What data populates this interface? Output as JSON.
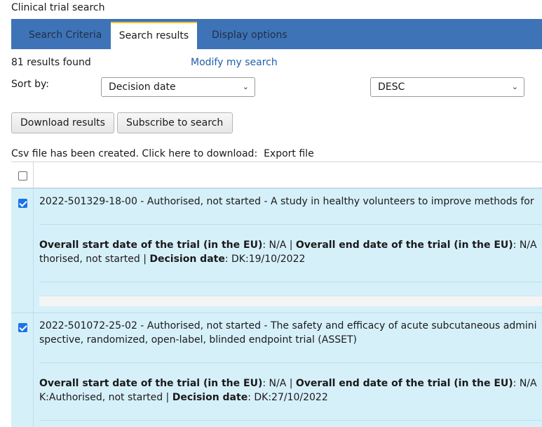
{
  "page_title": "Clinical trial search",
  "tabs": [
    {
      "label": "Search Criteria"
    },
    {
      "label": "Search results"
    },
    {
      "label": "Display options"
    }
  ],
  "results_count": "81 results found",
  "modify_link": "Modify my search",
  "sort": {
    "label": "Sort by:",
    "field": "Decision date",
    "order": "DESC"
  },
  "buttons": {
    "download": "Download results",
    "subscribe": "Subscribe to search"
  },
  "csv": {
    "message": "Csv file has been created. Click here to download:",
    "link": "Export file"
  },
  "results": [
    {
      "title": "2022-501329-18-00 - Authorised, not started - A study in healthy volunteers to improve methods for",
      "title_cont": "",
      "start_label": "Overall start date of the trial (in the EU)",
      "start_value": ": N/A |",
      "end_label": "Overall end date of the trial (in the EU)",
      "end_value": ": N/A",
      "status_cont": "thorised, not started |",
      "decision_label": "Decision date",
      "decision_value": ": DK:19/10/2022",
      "checked": true
    },
    {
      "title": "2022-501072-25-02 - Authorised, not started - The safety and efficacy of acute subcutaneous admini",
      "title_cont": "spective, randomized, open-label, blinded endpoint trial (ASSET)",
      "start_label": "Overall start date of the trial (in the EU)",
      "start_value": ": N/A |",
      "end_label": "Overall end date of the trial (in the EU)",
      "end_value": ": N/A",
      "status_cont": "K:Authorised, not started |",
      "decision_label": "Decision date",
      "decision_value": ": DK:27/10/2022",
      "checked": true
    }
  ],
  "icons": {
    "select_chevron": "chevron-down-icon",
    "checkbox_checked": "checkmark-icon"
  },
  "colors": {
    "tab_bar": "#3f73b7",
    "active_tab_accent": "#f3c02b",
    "link": "#1f5fa8",
    "row_background": "#d6f0fa",
    "checkbox_checked": "#1a73e8"
  }
}
